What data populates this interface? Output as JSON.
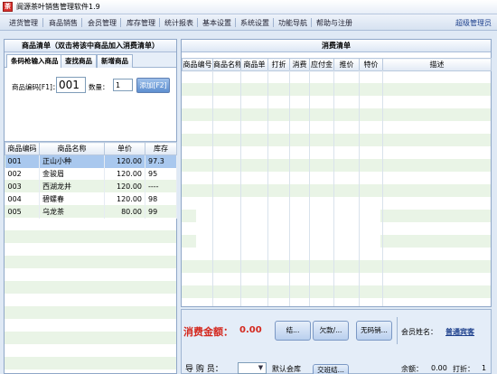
{
  "window": {
    "title": "阆源茶叶销售管理软件1.9"
  },
  "menu": {
    "items": [
      "进货管理",
      "商品销售",
      "会员管理",
      "库存管理",
      "统计报表",
      "基本设置",
      "系统设置",
      "功能导航",
      "帮助与注册"
    ],
    "user": "超级管理员"
  },
  "left_panel": {
    "title": "商品清单（双击将该中商品加入消费清单）",
    "tabs": [
      "条码枪输入商品",
      "查找商品",
      "新增商品"
    ],
    "code_label": "商品编码[F1]：",
    "code_value": "001",
    "qty_label": "数量：",
    "qty_value": "1",
    "add_button": "添加[F2]",
    "columns": [
      "商品编码",
      "商品名称",
      "单价",
      "库存"
    ],
    "rows": [
      {
        "code": "001",
        "name": "正山小种",
        "price": "120.00",
        "stock": "97.3"
      },
      {
        "code": "002",
        "name": "金骏眉",
        "price": "120.00",
        "stock": "95"
      },
      {
        "code": "003",
        "name": "西湖龙井",
        "price": "120.00",
        "stock": "----"
      },
      {
        "code": "004",
        "name": "碧螺春",
        "price": "120.00",
        "stock": "98"
      },
      {
        "code": "005",
        "name": "乌龙茶",
        "price": "80.00",
        "stock": "99"
      }
    ]
  },
  "right_panel": {
    "title": "消费清单",
    "columns": [
      "商品编号",
      "商品名称",
      "商品单",
      "打折",
      "消费",
      "应付金",
      "推价",
      "特价",
      "描述"
    ]
  },
  "bottom": {
    "amount_label": "消费金额：",
    "amount_value": "0.00",
    "btn1": "结...",
    "btn2": "欠款/...",
    "btn3": "无码销...",
    "btn4": "交班结...",
    "member_label": "会员姓名：",
    "member_value": "普通宾客",
    "guide_label": "导 购 员：",
    "default_label": "默认会库",
    "balance_label": "余额：",
    "balance_value": "0.00",
    "discount_label": "打折：",
    "discount_value": "1"
  },
  "colors": {
    "accent": "#1c3f8c",
    "amount": "#d4281e",
    "selected_row": "#a9c8ee",
    "stripe": "#e9f4e6"
  }
}
